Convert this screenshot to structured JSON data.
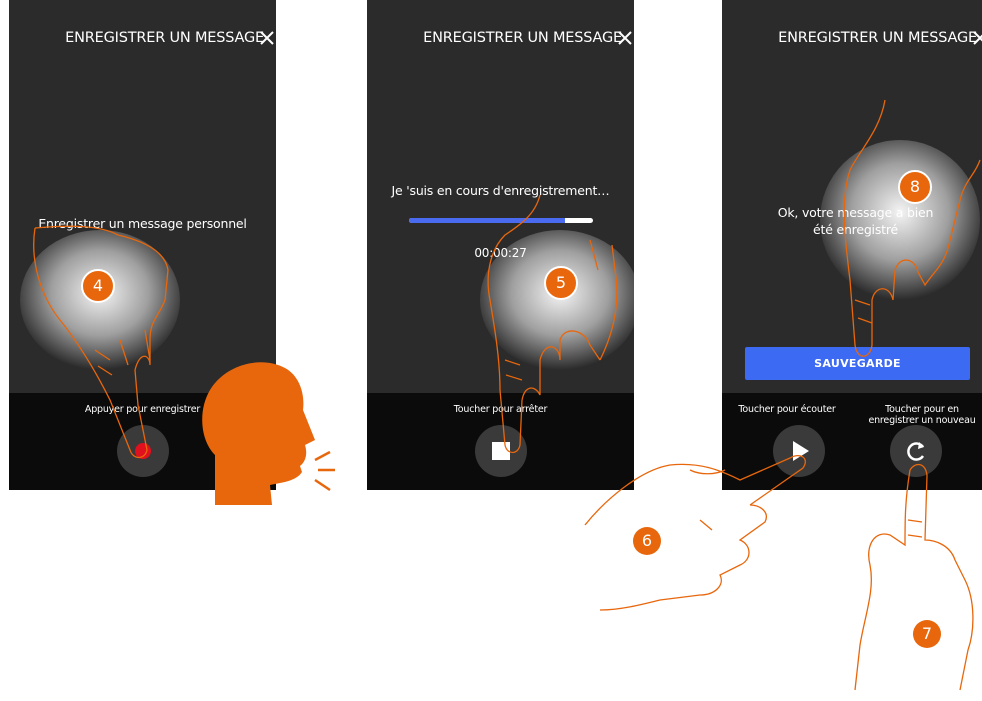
{
  "screen_title": "ENREGISTRER UN MESSAGE",
  "screen1": {
    "instruction": "Enregistrer un message personnel",
    "record_hint": "Appuyer pour enregistrer"
  },
  "screen2": {
    "status": "Je 'suis en cours d'enregistrement…",
    "progress": 0.85,
    "timer": "00:00:27",
    "stop_hint": "Toucher pour arrêter"
  },
  "screen3": {
    "confirmation_line1": "Ok, votre message a bien",
    "confirmation_line2": "été enregistré",
    "save_label": "SAUVEGARDE",
    "listen_hint": "Toucher pour écouter",
    "rerecord_hint_line1": "Toucher pour en",
    "rerecord_hint_line2": "enregistrer un nouveau"
  },
  "callouts": {
    "step4": "4",
    "step5": "5",
    "step6": "6",
    "step7": "7",
    "step8": "8"
  },
  "colors": {
    "screen_bg": "#2b2b2b",
    "bottom_bar": "#0b0b0b",
    "accent_blue": "#3d6af3",
    "callout_orange": "#e8670c",
    "record_red": "#e0101e"
  }
}
